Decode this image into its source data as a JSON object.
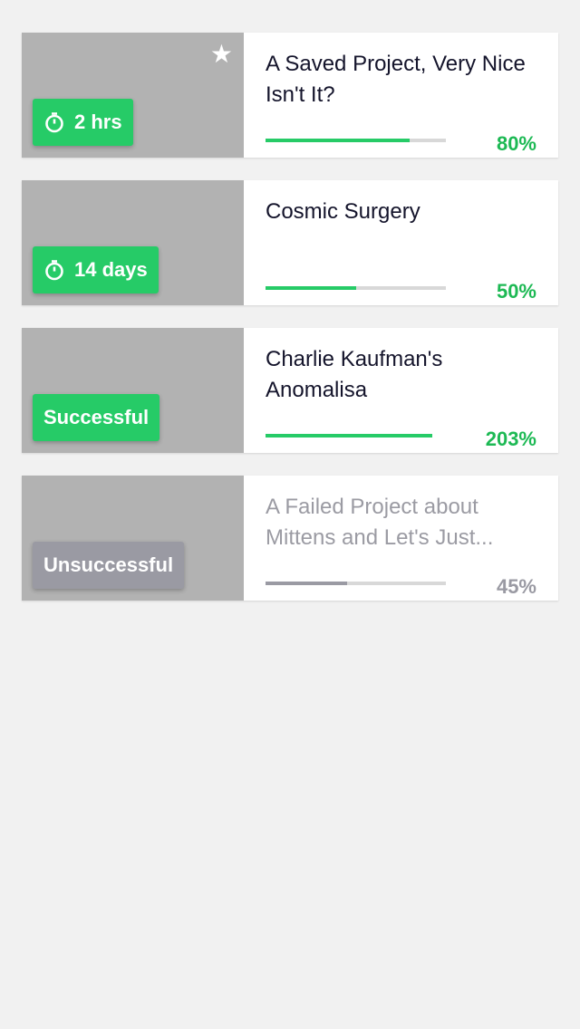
{
  "colors": {
    "success": "#26cb67",
    "success_text": "#1db954",
    "failed": "#9a9aa3"
  },
  "projects": [
    {
      "title": "A Saved Project, Very Nice Isn't It?",
      "badge": "2 hrs",
      "badge_icon": "stopwatch-icon",
      "saved": true,
      "percent_label": "80%",
      "progress": 80,
      "status": "active"
    },
    {
      "title": "Cosmic Surgery",
      "badge": "14 days",
      "badge_icon": "stopwatch-icon",
      "saved": false,
      "percent_label": "50%",
      "progress": 50,
      "status": "active"
    },
    {
      "title": "Charlie Kaufman's Anomalisa",
      "badge": "Successful",
      "saved": false,
      "percent_label": "203%",
      "progress": 203,
      "status": "successful"
    },
    {
      "title": "A Failed Project about Mittens and Let's Just...",
      "badge": "Unsuccessful",
      "saved": false,
      "percent_label": "45%",
      "progress": 45,
      "status": "failed"
    }
  ]
}
